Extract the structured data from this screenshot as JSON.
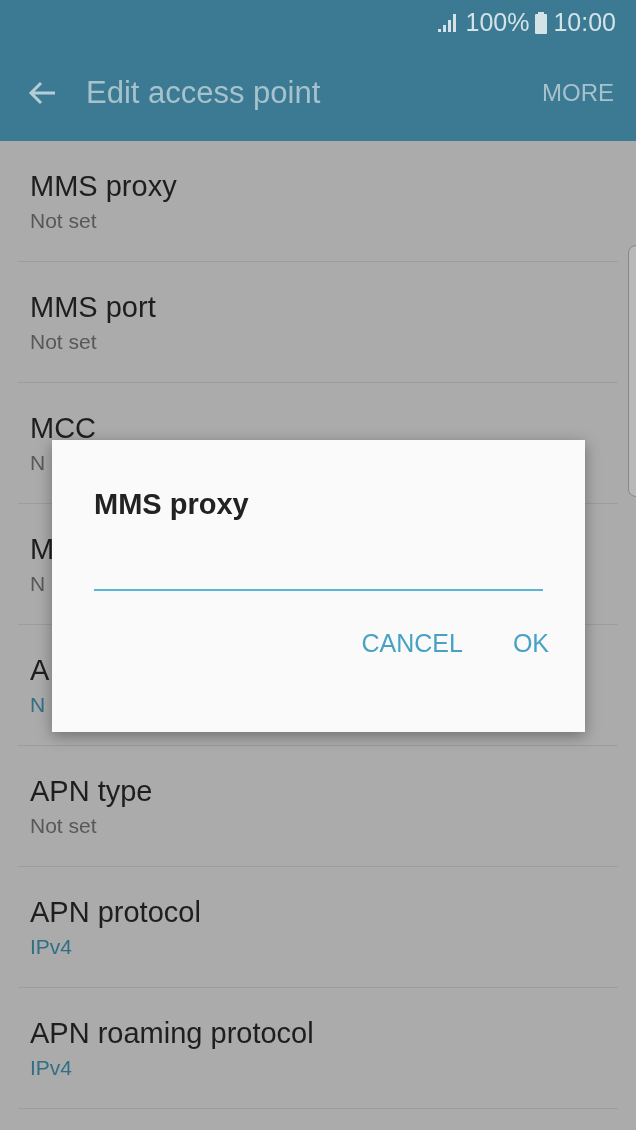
{
  "status_bar": {
    "battery": "100%",
    "time": "10:00"
  },
  "app_bar": {
    "title": "Edit access point",
    "menu": "MORE"
  },
  "settings": [
    {
      "title": "MMS proxy",
      "value": "Not set",
      "accent": false
    },
    {
      "title": "MMS port",
      "value": "Not set",
      "accent": false
    },
    {
      "title": "MCC",
      "value": "N",
      "accent": false
    },
    {
      "title": "M",
      "value": "N",
      "accent": false
    },
    {
      "title": "A",
      "value": "N",
      "accent": true
    },
    {
      "title": "APN type",
      "value": "Not set",
      "accent": false
    },
    {
      "title": "APN protocol",
      "value": "IPv4",
      "accent": true
    },
    {
      "title": "APN roaming protocol",
      "value": "IPv4",
      "accent": true
    }
  ],
  "dialog": {
    "title": "MMS proxy",
    "buttons": [
      "CANCEL",
      "OK"
    ]
  }
}
